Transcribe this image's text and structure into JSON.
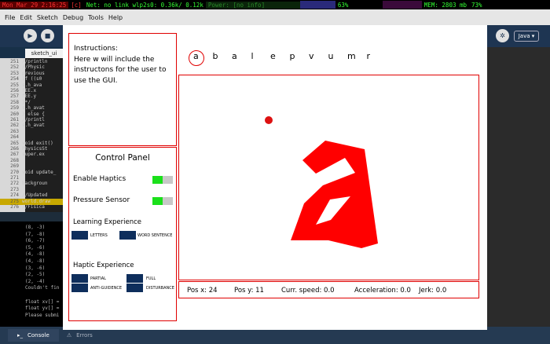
{
  "sysbar": {
    "clock": "Mon Mar 29  2:16:25",
    "flag": "[c]",
    "net": "Net: no link wlp2s0:  0.36k/ 0.12k",
    "power": "Power: [no info]",
    "cpu_pct": "63%",
    "mem": "MEM: 2803 mb",
    "mem_pct": "73%"
  },
  "menubar": {
    "items": [
      "File",
      "Edit",
      "Sketch",
      "Debug",
      "Tools",
      "Help"
    ]
  },
  "toolbar": {
    "run_icon": "play-icon",
    "stop_icon": "stop-icon",
    "mode": "Java"
  },
  "editor": {
    "tab": "sketch_ui",
    "lines": [
      {
        "no": "251",
        "text": "//println"
      },
      {
        "no": "252",
        "text": "//Physic"
      },
      {
        "no": "253",
        "text": "previous"
      },
      {
        "no": "254",
        "text": "if ((s0"
      },
      {
        "no": "255",
        "text": "s.h_ava"
      },
      {
        "no": "256",
        "text": "fEE.x"
      },
      {
        "no": "257",
        "text": "fEE.y"
      },
      {
        "no": "258",
        "text": "}*/"
      },
      {
        "no": "259",
        "text": "s.h_avat"
      },
      {
        "no": "260",
        "text": "} else {"
      },
      {
        "no": "261",
        "text": "//printl"
      },
      {
        "no": "262",
        "text": "s.h_avat"
      },
      {
        "no": "263",
        "text": ""
      },
      {
        "no": "264",
        "text": ""
      },
      {
        "no": "265",
        "text": "void exit()"
      },
      {
        "no": "266",
        "text": "PhysicsSt"
      },
      {
        "no": "267",
        "text": "super.ex"
      },
      {
        "no": "268",
        "text": ""
      },
      {
        "no": "269",
        "text": ""
      },
      {
        "no": "270",
        "text": "void update_"
      },
      {
        "no": "271",
        "text": ""
      },
      {
        "no": "272",
        "text": "backgroun"
      },
      {
        "no": "273",
        "text": ""
      },
      {
        "no": "274",
        "text": "//Updated"
      },
      {
        "no": "275",
        "text": "world.draw"
      },
      {
        "no": "276",
        "text": "//Fisica"
      }
    ]
  },
  "console": {
    "lines": [
      "(8, -3)",
      "(7, -8)",
      "(6, -7)",
      "(5, -6)",
      "(4, -8)",
      "(4, -8)",
      "(3, -6)",
      "(2, -5)",
      "(2, -4)",
      "Couldn't fin",
      "",
      "float xv[] =",
      "float yv[] =",
      "Please submi"
    ],
    "tabs": {
      "console": "Console",
      "errors": "Errors"
    }
  },
  "sketch": {
    "instructions": {
      "heading": "Instructions:",
      "body": "Here w will include the instructons for the user to use the GUI."
    },
    "control_panel": {
      "title": "Control Panel",
      "enable_haptics": "Enable Haptics",
      "pressure_sensor": "Pressure Sensor",
      "learning_title": "Learning Experience",
      "letters": "LETTERS",
      "word_sentence": "WORD SENTENCE",
      "haptic_title": "Haptic Experience",
      "partial": "PARTIAL",
      "full": "FULL",
      "anti_guidence": "ANTI-GUIDENCE",
      "disturbance": "DISTURBANCE"
    },
    "letters": [
      "a",
      "b",
      "a",
      "l",
      "e",
      "p",
      "v",
      "u",
      "m",
      "r"
    ],
    "selected_letter_index": 0,
    "glyph_color": "#ff0000",
    "info": {
      "pos_x": "Pos x: 24",
      "pos_y": "Pos y: 11",
      "speed": "Curr. speed: 0.0",
      "accel": "Acceleration: 0.0",
      "jerk": "Jerk: 0.0"
    }
  }
}
